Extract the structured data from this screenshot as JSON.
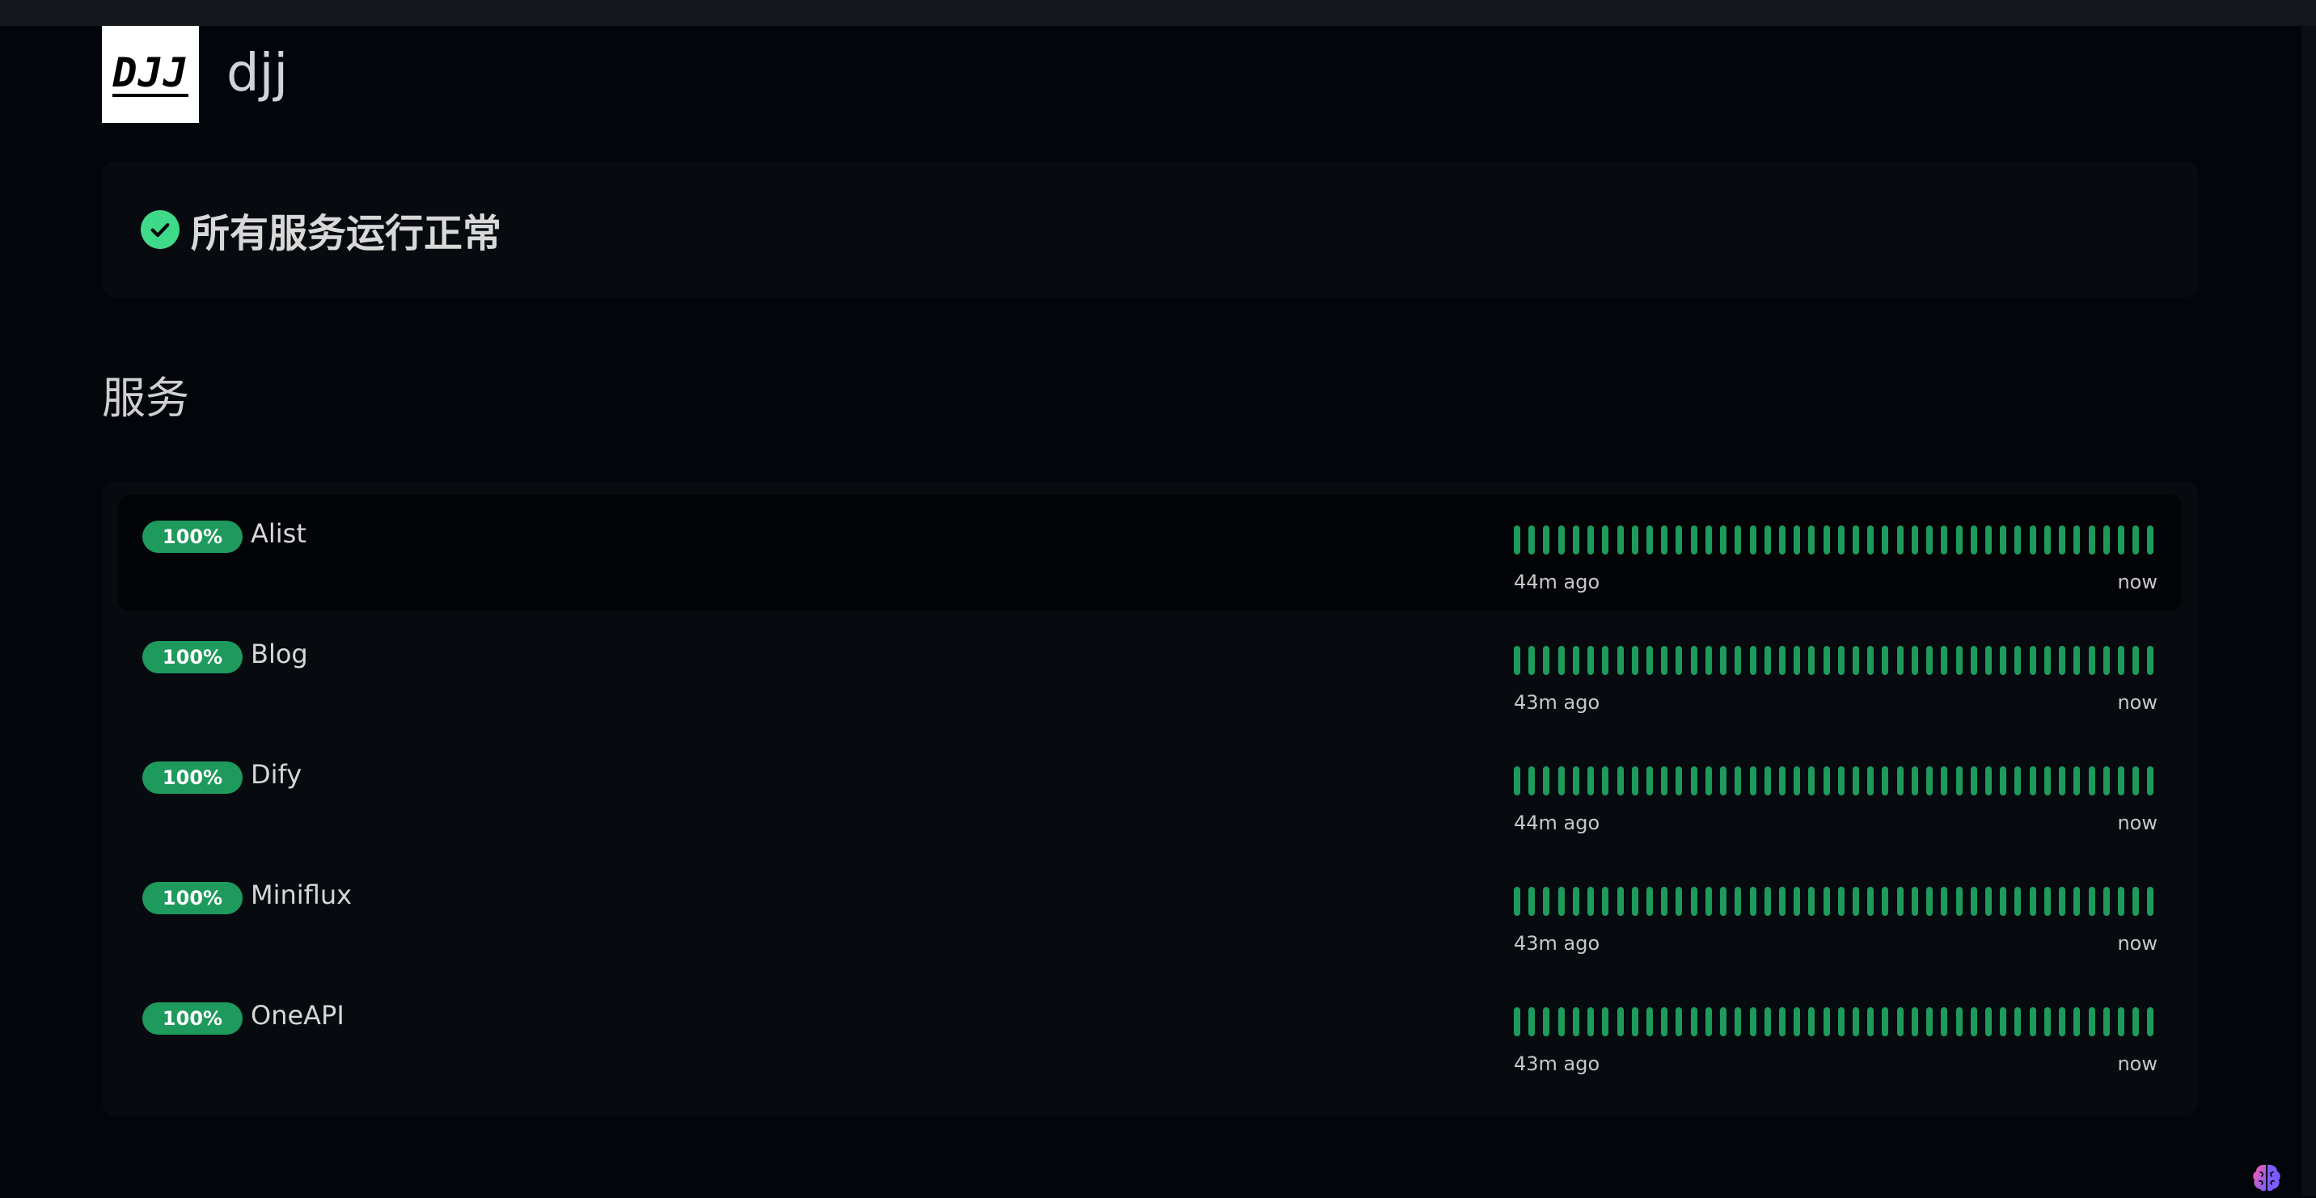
{
  "header": {
    "logo_text": "DJJ",
    "site_name": "djj"
  },
  "status": {
    "icon": "check-circle-icon",
    "text": "所有服务运行正常",
    "color": "#3fd98a"
  },
  "section_title": "服务",
  "colors": {
    "up": "#1e9a5d",
    "background": "#02050a",
    "card": "#070b10"
  },
  "services": [
    {
      "uptime": "100%",
      "name": "Alist",
      "since": "44m ago",
      "until": "now",
      "status_bars_up": 44
    },
    {
      "uptime": "100%",
      "name": "Blog",
      "since": "43m ago",
      "until": "now",
      "status_bars_up": 44
    },
    {
      "uptime": "100%",
      "name": "Dify",
      "since": "44m ago",
      "until": "now",
      "status_bars_up": 44
    },
    {
      "uptime": "100%",
      "name": "Miniflux",
      "since": "43m ago",
      "until": "now",
      "status_bars_up": 44
    },
    {
      "uptime": "100%",
      "name": "OneAPI",
      "since": "43m ago",
      "until": "now",
      "status_bars_up": 44
    }
  ],
  "floating_icon": "brain-icon"
}
